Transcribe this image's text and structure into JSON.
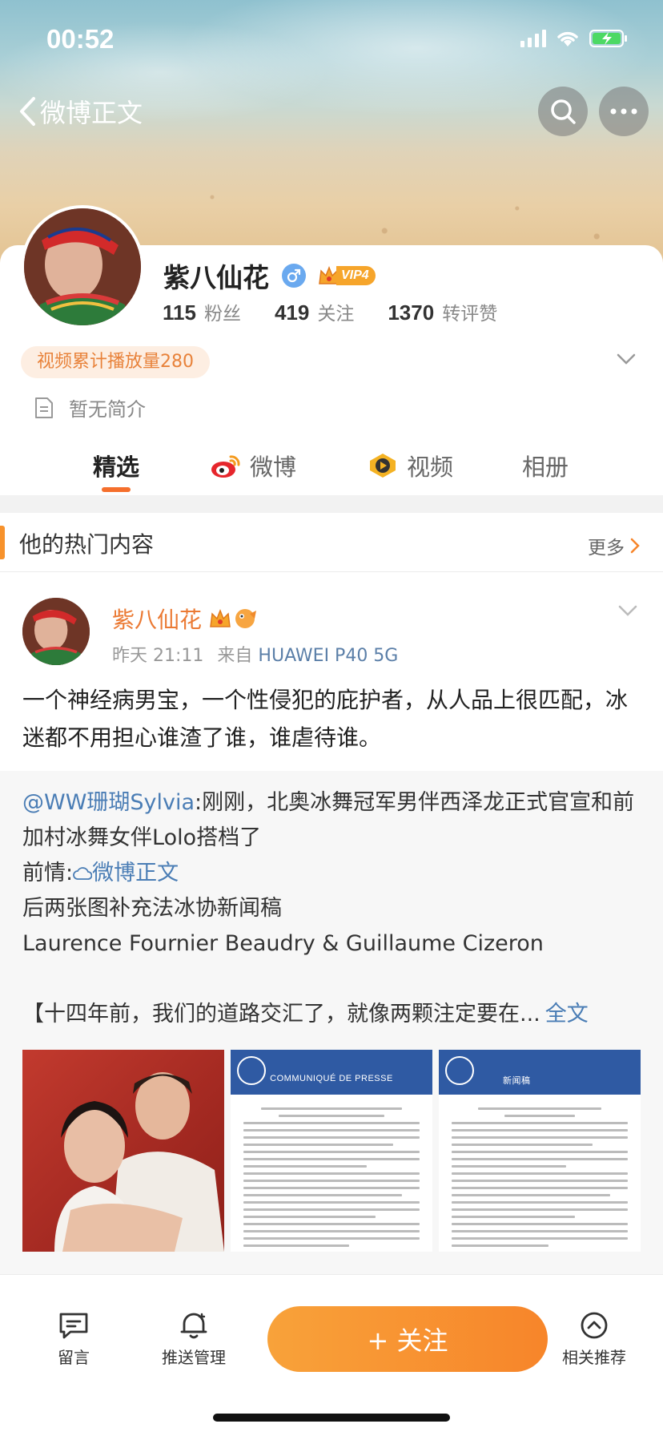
{
  "status_bar": {
    "time": "00:52"
  },
  "nav": {
    "back_label": "微博正文"
  },
  "profile": {
    "nickname": "紫八仙花",
    "vip_label": "VIP4",
    "stats": [
      {
        "num": "115",
        "label": "粉丝"
      },
      {
        "num": "419",
        "label": "关注"
      },
      {
        "num": "1370",
        "label": "转评赞"
      }
    ],
    "video_pill": "视频累计播放量280",
    "bio": "暂无简介"
  },
  "tabs": [
    {
      "label": "精选",
      "active": true
    },
    {
      "label": "微博",
      "icon": "weibo-icon"
    },
    {
      "label": "视频",
      "icon": "video-icon"
    },
    {
      "label": "相册"
    }
  ],
  "hot_section": {
    "title": "他的热门内容",
    "more": "更多"
  },
  "post": {
    "author": "紫八仙花",
    "time": "昨天 21:11",
    "source_prefix": "来自",
    "device": "HUAWEI P40 5G",
    "text": "一个神经病男宝，一个性侵犯的庇护者，从人品上很匹配，冰迷都不用担心谁渣了谁，谁虐待谁。",
    "repost": {
      "mention": "@WW珊瑚Sylvia",
      "line1_rest": ":刚刚，北奥冰舞冠军男伴西泽龙正式官宣和前加村冰舞女伴Lolo搭档了",
      "prefix2": "前情:",
      "link2": "微博正文",
      "line3": "后两张图补充法冰协新闻稿",
      "line4": "Laurence Fournier Beaudry & Guillaume Cizeron",
      "line5": "【十四年前，我们的道路交汇了，就像两颗注定要在...",
      "full_text": "全文",
      "doc1_title": "COMMUNIQUÉ DE PRESSE",
      "doc2_title": "新闻稿"
    }
  },
  "bottom_bar": {
    "message": "留言",
    "push": "推送管理",
    "follow": "+ 关注",
    "related": "相关推荐"
  },
  "colors": {
    "accent": "#f7852a",
    "link": "#4a7db5",
    "name": "#eb7a34"
  }
}
